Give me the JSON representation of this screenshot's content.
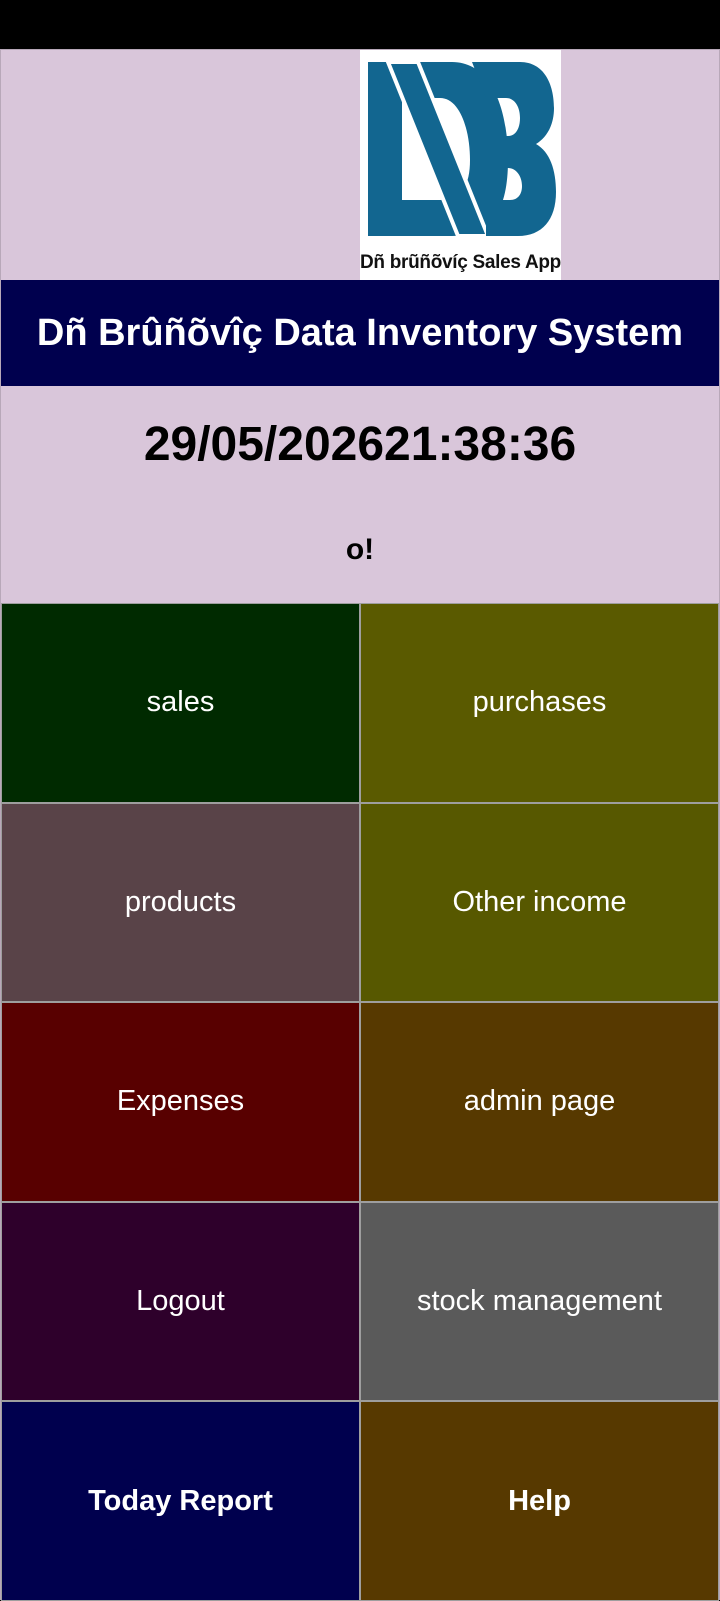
{
  "header": {
    "logo_caption": "Dñ brũñõvíç Sales App",
    "title": "Dñ Brûñõvîç Data Inventory System",
    "date": "29/05/2026",
    "time": "21:38:36",
    "greeting": "o!"
  },
  "colors": {
    "logo_blue": "#126690",
    "title_bg": "#00004e",
    "app_bg": "#d9c6da"
  },
  "menu": [
    {
      "label": "sales",
      "color": "#002a00"
    },
    {
      "label": "purchases",
      "color": "#5a5a00"
    },
    {
      "label": "products",
      "color": "#594348"
    },
    {
      "label": "Other income",
      "color": "#575800"
    },
    {
      "label": "Expenses",
      "color": "#580000"
    },
    {
      "label": "admin page",
      "color": "#573900"
    },
    {
      "label": "Logout",
      "color": "#2e002b"
    },
    {
      "label": "stock management",
      "color": "#5a5a5a"
    },
    {
      "label": "Today Report",
      "color": "#00004e",
      "bold": true
    },
    {
      "label": "Help",
      "color": "#573900",
      "bold": true
    }
  ]
}
